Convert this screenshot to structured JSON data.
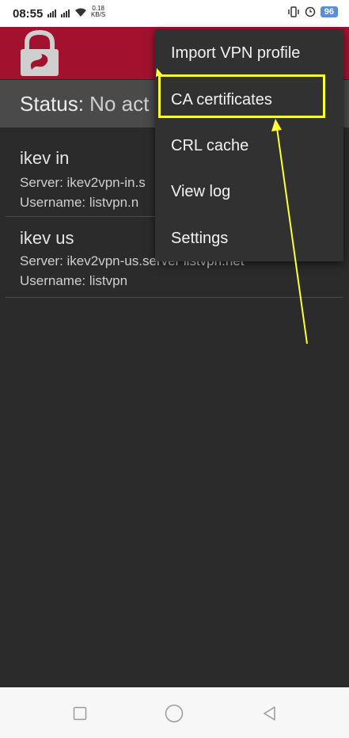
{
  "status_bar": {
    "time": "08:55",
    "net_speed_value": "0.18",
    "net_speed_unit": "KB/S",
    "battery": "96",
    "icons": [
      "signal-icon",
      "signal-icon",
      "wifi-icon",
      "vibrate-icon",
      "alarm-icon",
      "battery-icon"
    ]
  },
  "app": {
    "logo": "lock-logo-icon",
    "brand_color": "#a2122f"
  },
  "status": {
    "label": "Status:",
    "value": "No act"
  },
  "profiles": [
    {
      "name": "ikev in",
      "server": "Server: ikev2vpn-in.s",
      "username": "Username: listvpn.n"
    },
    {
      "name": "ikev us",
      "server": "Server: ikev2vpn-us.server listvpn.net",
      "username": "Username: listvpn"
    }
  ],
  "menu": {
    "items": [
      {
        "label": "Import VPN profile"
      },
      {
        "label": "CA certificates"
      },
      {
        "label": "CRL cache"
      },
      {
        "label": "View log"
      },
      {
        "label": "Settings"
      }
    ],
    "highlight_color": "#ffff33"
  },
  "nav_bar": {
    "icons": [
      "recents-square-icon",
      "home-circle-icon",
      "back-triangle-icon"
    ]
  }
}
